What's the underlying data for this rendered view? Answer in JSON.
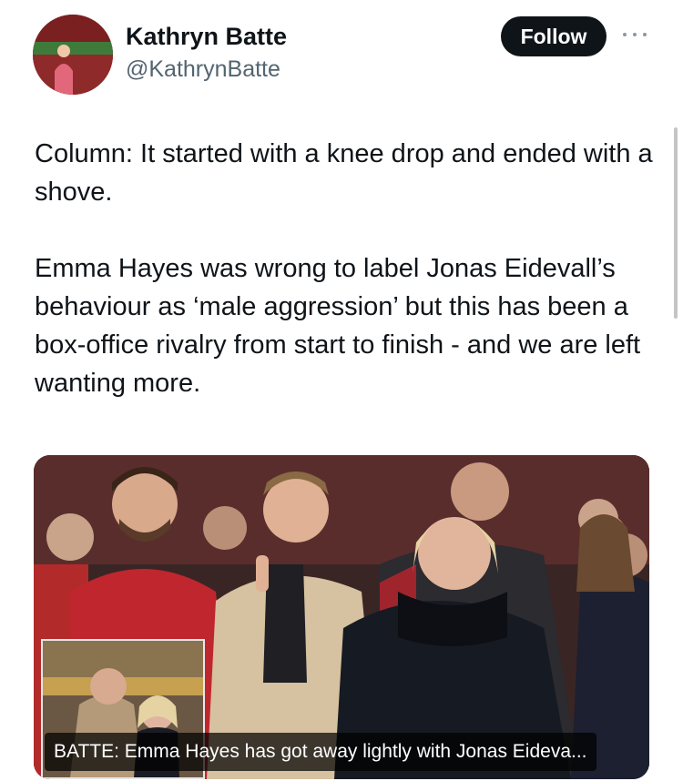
{
  "author": {
    "display_name": "Kathryn Batte",
    "handle": "@KathrynBatte"
  },
  "actions": {
    "follow_label": "Follow",
    "more_icon": "more-dots-icon"
  },
  "tweet": {
    "paragraphs": [
      "Column: It started with a knee drop and ended with a shove.",
      "Emma Hayes was wrong to label Jonas Eidevall’s behaviour as ‘male aggression’ but this has been a box-office rivalry from start to finish - and we are left wanting more."
    ]
  },
  "media": {
    "caption": "BATTE: Emma Hayes has got away lightly with Jonas Eideva..."
  },
  "colors": {
    "text": "#0f1419",
    "secondary": "#536471",
    "follow_bg": "#0f1419"
  }
}
